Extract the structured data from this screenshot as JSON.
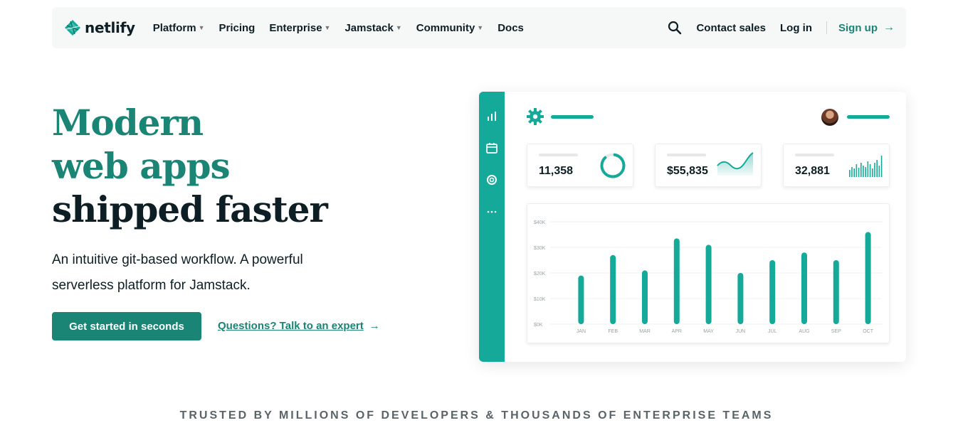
{
  "brand": {
    "name": "netlify",
    "accent": "#1a8475",
    "teal": "#15a99a"
  },
  "nav": {
    "items": [
      {
        "label": "Platform",
        "dropdown": true
      },
      {
        "label": "Pricing",
        "dropdown": false
      },
      {
        "label": "Enterprise",
        "dropdown": true
      },
      {
        "label": "Jamstack",
        "dropdown": true
      },
      {
        "label": "Community",
        "dropdown": true
      },
      {
        "label": "Docs",
        "dropdown": false
      }
    ],
    "search_icon": "search-icon",
    "contact": "Contact sales",
    "login": "Log in",
    "signup": "Sign up",
    "signup_arrow": "→"
  },
  "hero": {
    "title_line1": "Modern",
    "title_line2": "web apps",
    "title_line3": "shipped faster",
    "subtitle": "An intuitive git-based workflow. A powerful serverless platform for Jamstack.",
    "cta": "Get started in seconds",
    "expert_link": "Questions? Talk to an expert",
    "expert_arrow": "→"
  },
  "dashboard": {
    "stats": [
      {
        "value": "11,358",
        "viz": "ring",
        "ring_fraction": 0.85
      },
      {
        "value": "$55,835",
        "viz": "area"
      },
      {
        "value": "32,881",
        "viz": "bars"
      }
    ]
  },
  "chart_data": {
    "type": "bar",
    "categories": [
      "JAN",
      "FEB",
      "MAR",
      "APR",
      "MAY",
      "JUN",
      "JUL",
      "AUG",
      "SEP",
      "OCT"
    ],
    "values": [
      19,
      27,
      21,
      33.5,
      31,
      20,
      25,
      28,
      25,
      36
    ],
    "yticks": [
      "$0K",
      "$10K",
      "$20K",
      "$30K",
      "$40K"
    ],
    "ylim": [
      0,
      40
    ],
    "grid": true,
    "color": "#15a99a"
  },
  "trusted": "TRUSTED BY MILLIONS OF DEVELOPERS & THOUSANDS OF ENTERPRISE TEAMS"
}
